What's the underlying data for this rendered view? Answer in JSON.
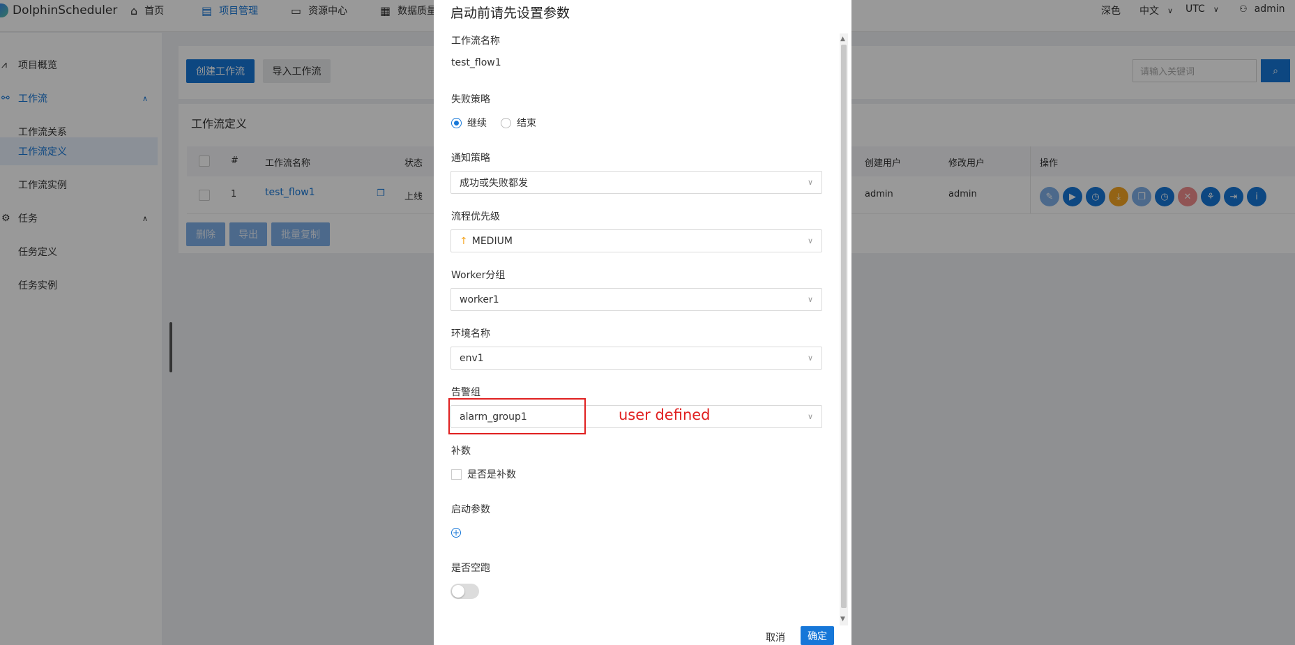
{
  "app": {
    "name": "DolphinScheduler"
  },
  "topnav": {
    "items": [
      {
        "label": "首页",
        "icon": "home-icon"
      },
      {
        "label": "项目管理",
        "icon": "project-icon",
        "active": true
      },
      {
        "label": "资源中心",
        "icon": "folder-icon"
      },
      {
        "label": "数据质量",
        "icon": "data-quality-icon"
      }
    ],
    "theme": "深色",
    "language": "中文",
    "timezone": "UTC",
    "user": "admin"
  },
  "sidebar": {
    "items": [
      {
        "label": "项目概览"
      },
      {
        "label": "工作流"
      },
      {
        "label": "工作流关系"
      },
      {
        "label": "工作流定义"
      },
      {
        "label": "工作流实例"
      },
      {
        "label": "任务"
      },
      {
        "label": "任务定义"
      },
      {
        "label": "任务实例"
      }
    ]
  },
  "toolbar": {
    "create_label": "创建工作流",
    "import_label": "导入工作流",
    "search_placeholder": "请输入关键词"
  },
  "list": {
    "title": "工作流定义",
    "columns": [
      "#",
      "工作流名称",
      "状态",
      "创建用户",
      "修改用户",
      "操作"
    ],
    "row": {
      "index": "1",
      "name": "test_flow1",
      "status": "上线",
      "creator": "admin",
      "modifier": "admin"
    },
    "bottom_buttons": [
      "删除",
      "导出",
      "批量复制"
    ]
  },
  "dialog": {
    "title": "启动前请先设置参数",
    "workflow_name_label": "工作流名称",
    "workflow_name": "test_flow1",
    "failure_strategy_label": "失败策略",
    "failure_options": [
      "继续",
      "结束"
    ],
    "notify_label": "通知策略",
    "notify_value": "成功或失败都发",
    "priority_label": "流程优先级",
    "priority_value": "MEDIUM",
    "worker_label": "Worker分组",
    "worker_value": "worker1",
    "env_label": "环境名称",
    "env_value": "env1",
    "alarm_label": "告警组",
    "alarm_value": "alarm_group1",
    "complement_label": "补数",
    "complement_option": "是否是补数",
    "startup_params_label": "启动参数",
    "dry_run_label": "是否空跑",
    "cancel_label": "取消",
    "confirm_label": "确定"
  },
  "annotation": {
    "text": "user defined",
    "color": "#e02020"
  },
  "colors": {
    "primary": "#1677d8",
    "warning": "#f5a623",
    "danger": "#f08c8c"
  }
}
